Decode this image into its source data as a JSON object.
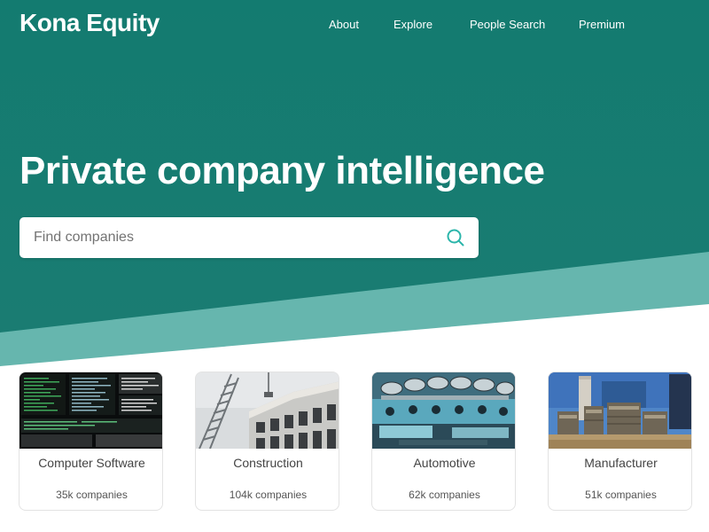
{
  "brand": {
    "name": "Kona Equity"
  },
  "nav": {
    "items": [
      {
        "label": "About"
      },
      {
        "label": "Explore"
      },
      {
        "label": "People Search"
      },
      {
        "label": "Premium"
      }
    ]
  },
  "hero": {
    "title": "Private company intelligence",
    "search_placeholder": "Find companies",
    "search_value": ""
  },
  "industries": [
    {
      "name": "Computer Software",
      "count": "35k companies"
    },
    {
      "name": "Construction",
      "count": "104k companies"
    },
    {
      "name": "Automotive",
      "count": "62k companies"
    },
    {
      "name": "Manufacturer",
      "count": "51k companies"
    }
  ],
  "colors": {
    "primary_teal": "#137a6f",
    "light_teal": "#66b6ae",
    "search_icon": "#2bb5aa",
    "white": "#ffffff"
  },
  "icons": {
    "search": "search-icon"
  }
}
